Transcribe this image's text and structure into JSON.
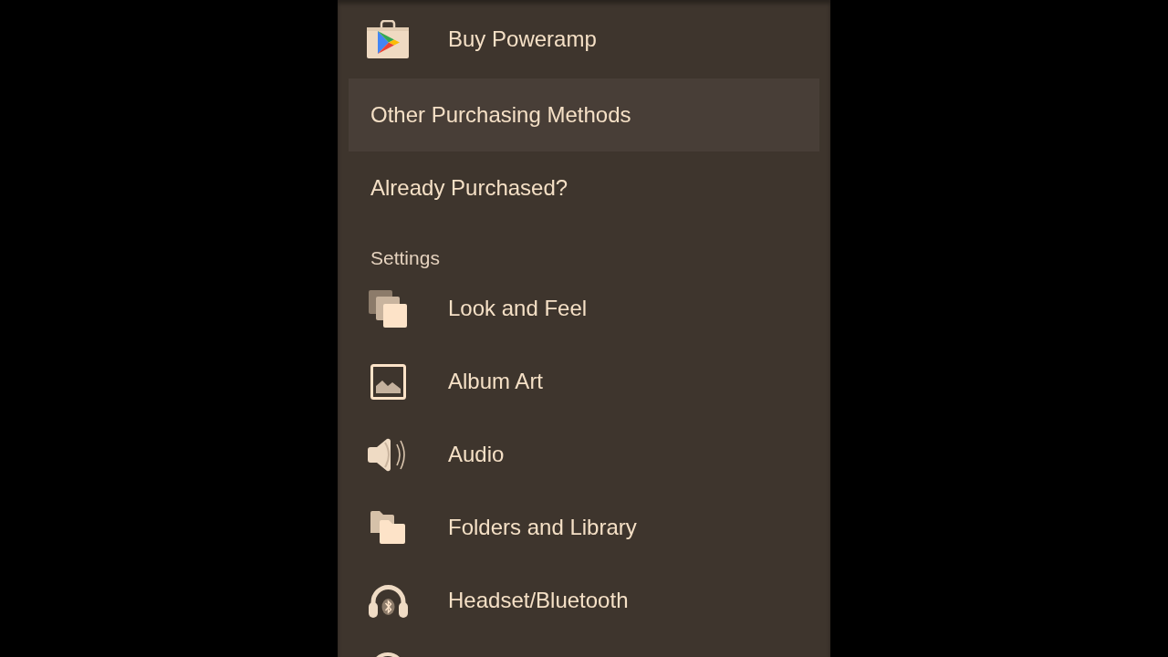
{
  "drawer": {
    "items": [
      {
        "kind": "icon",
        "label": "Buy Poweramp",
        "selected": false
      },
      {
        "kind": "text",
        "label": "Other Purchasing Methods",
        "selected": true
      },
      {
        "kind": "text",
        "label": "Already Purchased?",
        "selected": false
      },
      {
        "kind": "header",
        "label": "Settings"
      },
      {
        "kind": "icon",
        "label": "Look and Feel",
        "selected": false
      },
      {
        "kind": "icon",
        "label": "Album Art",
        "selected": false
      },
      {
        "kind": "icon",
        "label": "Audio",
        "selected": false
      },
      {
        "kind": "icon",
        "label": "Folders and Library",
        "selected": false
      },
      {
        "kind": "icon",
        "label": "Headset/Bluetooth",
        "selected": false
      }
    ]
  }
}
